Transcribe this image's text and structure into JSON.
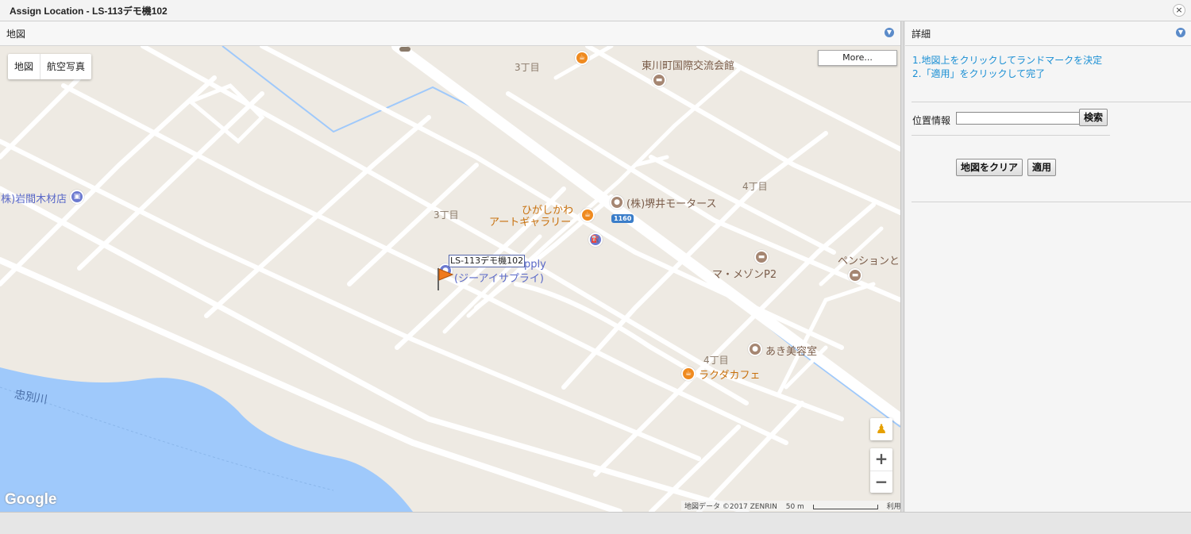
{
  "window": {
    "title": "Assign Location - LS-113デモ機102",
    "close_glyph": "×"
  },
  "map_panel": {
    "header": "地図",
    "map_type_options": [
      "地図",
      "航空写真"
    ],
    "more_button": "More...",
    "street_labels": [
      "3丁目",
      "3丁目",
      "4丁目",
      "4丁目"
    ],
    "river_label": "忠別川",
    "route_badge": "1160",
    "pois": {
      "community_hall": "東川町国際交流会館",
      "art_gallery_line1": "ひがしかわ",
      "art_gallery_line2": "アートギャラリー",
      "motors": "(株)堺井モータース",
      "maison": "マ・メゾンP2",
      "pension": "ペンションと",
      "beauty_salon": "あき美容室",
      "rakuda_cafe": "ラクダカフェ",
      "lumber": "(株)岩間木材店",
      "supply_line1": "pply",
      "supply_line2": "(ジーアイサプライ)"
    },
    "marker_label": "LS-113デモ機102",
    "zoom_in": "+",
    "zoom_out": "−",
    "google_logo": "Google",
    "attribution": "地図データ ©2017 ZENRIN",
    "scale": "50 m",
    "terms": "利用規約"
  },
  "details_panel": {
    "header": "詳細",
    "instruction_1": "1.地図上をクリックしてランドマークを決定",
    "instruction_2": "2.「適用」をクリックして完了",
    "location_label": "位置情報",
    "location_value": "",
    "search_button": "検索",
    "clear_button": "地図をクリア",
    "apply_button": "適用"
  },
  "colors": {
    "map_background": "#eeeae3",
    "road": "#ffffff",
    "river": "#9fc9fb",
    "instruction_text": "#1a8fd4",
    "poi_orange": "#ef8a1f",
    "poi_brown": "#a58672",
    "poi_blue": "#6c7ad0"
  }
}
